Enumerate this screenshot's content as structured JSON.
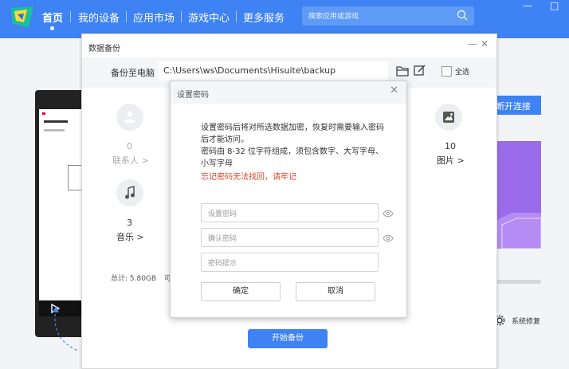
{
  "nav": {
    "items": [
      "首页",
      "我的设备",
      "应用市场",
      "游戏中心",
      "更多服务"
    ],
    "search_placeholder": "搜索应用或游戏",
    "window_controls": [
      "—",
      "□"
    ]
  },
  "background": {
    "disconnect_label": "断开连接",
    "repair_label": "系统修复"
  },
  "backup_dialog": {
    "title": "数据备份",
    "path_label": "备份至电脑",
    "path_value": "C:\\Users\\ws\\Documents\\Hisuite\\backup",
    "select_all_label": "全选",
    "categories": [
      {
        "count": "0",
        "label": "联系人 >",
        "icon": "contact-icon"
      },
      {
        "count": "10",
        "label": "图片 >",
        "icon": "picture-icon"
      },
      {
        "count": "3",
        "label": "音乐 >",
        "icon": "music-icon"
      }
    ],
    "total_label": "总计: 5.80GB",
    "total_suffix": "可",
    "start_button": "开始备份"
  },
  "password_dialog": {
    "title": "设置密码",
    "description": "设置密码后将对所选数据加密，恢复时需要输入密码后才能访问。\n密码由 8-32 位字符组成，须包含数字、大写字母、小写字母",
    "warning": "忘记密码无法找回，请牢记",
    "password_placeholder": "设置密码",
    "confirm_placeholder": "确认密码",
    "hint_placeholder": "密码提示",
    "confirm_button": "确定",
    "cancel_button": "取消"
  },
  "colors": {
    "brand": "#3e82f4",
    "warning": "#e0442b",
    "purple": "#9a6bea"
  }
}
